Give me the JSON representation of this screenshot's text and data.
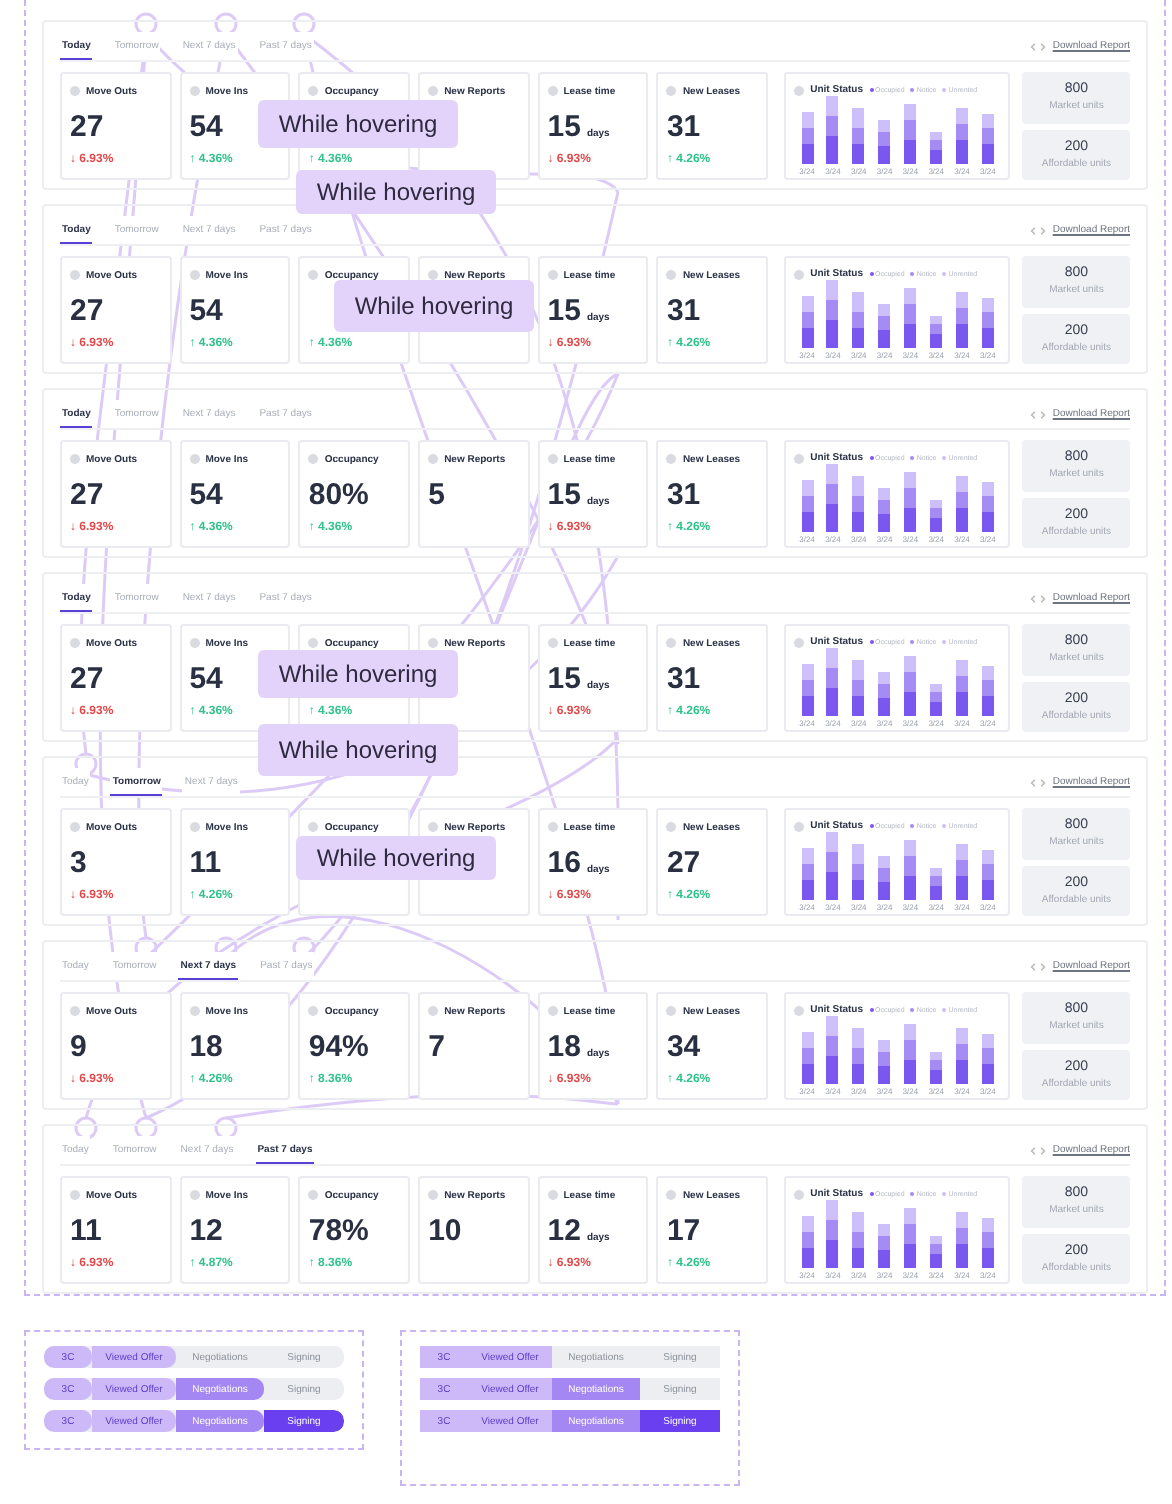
{
  "panels": [
    {
      "tabs": [
        {
          "label": "Today",
          "selected": true
        },
        {
          "label": "Tomorrow",
          "selected": false
        },
        {
          "label": "Next 7 days",
          "selected": false
        },
        {
          "label": "Past 7 days",
          "selected": false
        }
      ],
      "download": "Download Report",
      "cards": [
        {
          "title": "Move Outs",
          "value": "27",
          "change": "↓ 6.93%",
          "color": "#e04848"
        },
        {
          "title": "Move Ins",
          "value": "54",
          "change": "↑ 4.36%",
          "color": "#2fc28a"
        },
        {
          "title": "Occupancy",
          "change": "↑ 4.36%",
          "color": "#2fc28a"
        },
        {
          "title": "New Reports"
        },
        {
          "title": "Lease time",
          "value": "15",
          "unit": "days",
          "change": "↓ 6.93%",
          "color": "#e04848"
        },
        {
          "title": "New Leases",
          "value": "31",
          "change": "↑ 4.26%",
          "color": "#2fc28a"
        }
      ],
      "chart": {
        "title": "Unit Status",
        "legend": [
          "Occupied",
          "Notice",
          "Unrented"
        ],
        "categories": [
          "3/24",
          "3/24",
          "3/24",
          "3/24",
          "3/24",
          "3/24",
          "3/24",
          "3/24"
        ]
      },
      "units": [
        {
          "value": "800",
          "label": "Market units"
        },
        {
          "value": "200",
          "label": "Affordable units"
        }
      ]
    },
    {
      "tabs": [
        {
          "label": "Today",
          "selected": true
        },
        {
          "label": "Tomorrow",
          "selected": false
        },
        {
          "label": "Next 7 days",
          "selected": false
        },
        {
          "label": "Past 7 days",
          "selected": false
        }
      ],
      "download": "Download Report",
      "cards": [
        {
          "title": "Move Outs",
          "value": "27",
          "change": "↓ 6.93%",
          "color": "#e04848"
        },
        {
          "title": "Move Ins",
          "value": "54",
          "change": "↑ 4.36%",
          "color": "#2fc28a"
        },
        {
          "title": "Occupancy",
          "change": "↑ 4.36%",
          "color": "#2fc28a"
        },
        {
          "title": "New Reports"
        },
        {
          "title": "Lease time",
          "value": "15",
          "unit": "days",
          "change": "↓ 6.93%",
          "color": "#e04848"
        },
        {
          "title": "New Leases",
          "value": "31",
          "change": "↑ 4.26%",
          "color": "#2fc28a"
        }
      ],
      "chart": {
        "title": "Unit Status",
        "legend": [
          "Occupied",
          "Notice",
          "Unrented"
        ],
        "categories": [
          "3/24",
          "3/24",
          "3/24",
          "3/24",
          "3/24",
          "3/24",
          "3/24",
          "3/24"
        ]
      },
      "units": [
        {
          "value": "800",
          "label": "Market units"
        },
        {
          "value": "200",
          "label": "Affordable units"
        }
      ]
    },
    {
      "tabs": [
        {
          "label": "Today",
          "selected": true
        },
        {
          "label": "Tomorrow",
          "selected": false
        },
        {
          "label": "Next 7 days",
          "selected": false
        },
        {
          "label": "Past 7 days",
          "selected": false
        }
      ],
      "download": "Download Report",
      "cards": [
        {
          "title": "Move Outs",
          "value": "27",
          "change": "↓ 6.93%",
          "color": "#e04848"
        },
        {
          "title": "Move Ins",
          "value": "54",
          "change": "↑ 4.36%",
          "color": "#2fc28a"
        },
        {
          "title": "Occupancy",
          "value": "80%",
          "change": "↑ 4.36%",
          "color": "#2fc28a"
        },
        {
          "title": "New Reports",
          "value": "5"
        },
        {
          "title": "Lease time",
          "value": "15",
          "unit": "days",
          "change": "↓ 6.93%",
          "color": "#e04848"
        },
        {
          "title": "New Leases",
          "value": "31",
          "change": "↑ 4.26%",
          "color": "#2fc28a"
        }
      ],
      "chart": {
        "title": "Unit Status",
        "legend": [
          "Occupied",
          "Notice",
          "Unrented"
        ],
        "categories": [
          "3/24",
          "3/24",
          "3/24",
          "3/24",
          "3/24",
          "3/24",
          "3/24",
          "3/24"
        ]
      },
      "units": [
        {
          "value": "800",
          "label": "Market units"
        },
        {
          "value": "200",
          "label": "Affordable units"
        }
      ]
    },
    {
      "tabs": [
        {
          "label": "Today",
          "selected": true
        },
        {
          "label": "Tomorrow",
          "selected": false
        },
        {
          "label": "Next 7 days",
          "selected": false
        },
        {
          "label": "Past 7 days",
          "selected": false
        }
      ],
      "download": "Download Report",
      "cards": [
        {
          "title": "Move Outs",
          "value": "27",
          "change": "↓ 6.93%",
          "color": "#e04848"
        },
        {
          "title": "Move Ins",
          "value": "54",
          "change": "↑ 4.36%",
          "color": "#2fc28a"
        },
        {
          "title": "Occupancy",
          "change": "↑ 4.36%",
          "color": "#2fc28a"
        },
        {
          "title": "New Reports"
        },
        {
          "title": "Lease time",
          "value": "15",
          "unit": "days",
          "change": "↓ 6.93%",
          "color": "#e04848"
        },
        {
          "title": "New Leases",
          "value": "31",
          "change": "↑ 4.26%",
          "color": "#2fc28a"
        }
      ],
      "chart": {
        "title": "Unit Status",
        "legend": [
          "Occupied",
          "Notice",
          "Unrented"
        ],
        "categories": [
          "3/24",
          "3/24",
          "3/24",
          "3/24",
          "3/24",
          "3/24",
          "3/24",
          "3/24"
        ]
      },
      "units": [
        {
          "value": "800",
          "label": "Market units"
        },
        {
          "value": "200",
          "label": "Affordable units"
        }
      ]
    },
    {
      "tabs": [
        {
          "label": "Today",
          "selected": false
        },
        {
          "label": "Tomorrow",
          "selected": true
        },
        {
          "label": "Next 7 days",
          "selected": false
        }
      ],
      "download": "Download Report",
      "cards": [
        {
          "title": "Move Outs",
          "value": "3",
          "change": "↓ 6.93%",
          "color": "#e04848"
        },
        {
          "title": "Move Ins",
          "value": "11",
          "change": "↑ 4.26%",
          "color": "#2fc28a"
        },
        {
          "title": "Occupancy"
        },
        {
          "title": "New Reports"
        },
        {
          "title": "Lease time",
          "value": "16",
          "unit": "days",
          "change": "↓ 6.93%",
          "color": "#e04848"
        },
        {
          "title": "New Leases",
          "value": "27",
          "change": "↑ 4.26%",
          "color": "#2fc28a"
        }
      ],
      "chart": {
        "title": "Unit Status",
        "legend": [
          "Occupied",
          "Notice",
          "Unrented"
        ],
        "categories": [
          "3/24",
          "3/24",
          "3/24",
          "3/24",
          "3/24",
          "3/24",
          "3/24",
          "3/24"
        ]
      },
      "units": [
        {
          "value": "800",
          "label": "Market units"
        },
        {
          "value": "200",
          "label": "Affordable units"
        }
      ]
    },
    {
      "tabs": [
        {
          "label": "Today",
          "selected": false
        },
        {
          "label": "Tomorrow",
          "selected": false
        },
        {
          "label": "Next 7 days",
          "selected": true
        },
        {
          "label": "Past 7 days",
          "selected": false
        }
      ],
      "download": "Download Report",
      "cards": [
        {
          "title": "Move Outs",
          "value": "9",
          "change": "↓ 6.93%",
          "color": "#e04848"
        },
        {
          "title": "Move Ins",
          "value": "18",
          "change": "↑ 4.26%",
          "color": "#2fc28a"
        },
        {
          "title": "Occupancy",
          "value": "94%",
          "change": "↑ 8.36%",
          "color": "#2fc28a"
        },
        {
          "title": "New Reports",
          "value": "7"
        },
        {
          "title": "Lease time",
          "value": "18",
          "unit": "days",
          "change": "↓ 6.93%",
          "color": "#e04848"
        },
        {
          "title": "New Leases",
          "value": "34",
          "change": "↑ 4.26%",
          "color": "#2fc28a"
        }
      ],
      "chart": {
        "title": "Unit Status",
        "legend": [
          "Occupied",
          "Notice",
          "Unrented"
        ],
        "categories": [
          "3/24",
          "3/24",
          "3/24",
          "3/24",
          "3/24",
          "3/24",
          "3/24",
          "3/24"
        ]
      },
      "units": [
        {
          "value": "800",
          "label": "Market units"
        },
        {
          "value": "200",
          "label": "Affordable units"
        }
      ]
    },
    {
      "tabs": [
        {
          "label": "Today",
          "selected": false
        },
        {
          "label": "Tomorrow",
          "selected": false
        },
        {
          "label": "Next 7 days",
          "selected": false
        },
        {
          "label": "Past 7 days",
          "selected": true
        }
      ],
      "download": "Download Report",
      "cards": [
        {
          "title": "Move Outs",
          "value": "11",
          "change": "↓ 6.93%",
          "color": "#e04848"
        },
        {
          "title": "Move Ins",
          "value": "12",
          "change": "↑ 4.87%",
          "color": "#2fc28a"
        },
        {
          "title": "Occupancy",
          "value": "78%",
          "change": "↑ 8.36%",
          "color": "#2fc28a"
        },
        {
          "title": "New Reports",
          "value": "10"
        },
        {
          "title": "Lease time",
          "value": "12",
          "unit": "days",
          "change": "↓ 6.93%",
          "color": "#e04848"
        },
        {
          "title": "New Leases",
          "value": "17",
          "change": "↑ 4.26%",
          "color": "#2fc28a"
        }
      ],
      "chart": {
        "title": "Unit Status",
        "legend": [
          "Occupied",
          "Notice",
          "Unrented"
        ],
        "categories": [
          "3/24",
          "3/24",
          "3/24",
          "3/24",
          "3/24",
          "3/24",
          "3/24",
          "3/24"
        ]
      },
      "units": [
        {
          "value": "800",
          "label": "Market units"
        },
        {
          "value": "200",
          "label": "Affordable units"
        }
      ]
    }
  ],
  "hover_labels": [
    "While hovering",
    "While hovering",
    "While hovering",
    "While hovering",
    "While hovering",
    "While hovering"
  ],
  "progress_frames": [
    {
      "kind": "rounded",
      "rows": [
        {
          "steps": [
            {
              "label": "3C",
              "reached": true
            },
            {
              "label": "Viewed Offer",
              "reached": true
            },
            {
              "label": "Negotiations",
              "reached": false
            },
            {
              "label": "Signing",
              "reached": false
            }
          ]
        },
        {
          "steps": [
            {
              "label": "3C",
              "reached": true
            },
            {
              "label": "Viewed Offer",
              "reached": true
            },
            {
              "label": "Negotiations",
              "reached": true
            },
            {
              "label": "Signing",
              "reached": false
            }
          ]
        },
        {
          "steps": [
            {
              "label": "3C",
              "reached": true
            },
            {
              "label": "Viewed Offer",
              "reached": true
            },
            {
              "label": "Negotiations",
              "reached": true
            },
            {
              "label": "Signing",
              "reached": true
            }
          ]
        }
      ]
    },
    {
      "kind": "square",
      "rows": [
        {
          "steps": [
            {
              "label": "3C",
              "reached": true
            },
            {
              "label": "Viewed Offer",
              "reached": true
            },
            {
              "label": "Negotiations",
              "reached": false
            },
            {
              "label": "Signing",
              "reached": false
            }
          ]
        },
        {
          "steps": [
            {
              "label": "3C",
              "reached": true
            },
            {
              "label": "Viewed Offer",
              "reached": true
            },
            {
              "label": "Negotiations",
              "reached": true
            },
            {
              "label": "Signing",
              "reached": false
            }
          ]
        },
        {
          "steps": [
            {
              "label": "3C",
              "reached": true
            },
            {
              "label": "Viewed Offer",
              "reached": true
            },
            {
              "label": "Negotiations",
              "reached": true
            },
            {
              "label": "Signing",
              "reached": true
            }
          ]
        }
      ]
    }
  ]
}
